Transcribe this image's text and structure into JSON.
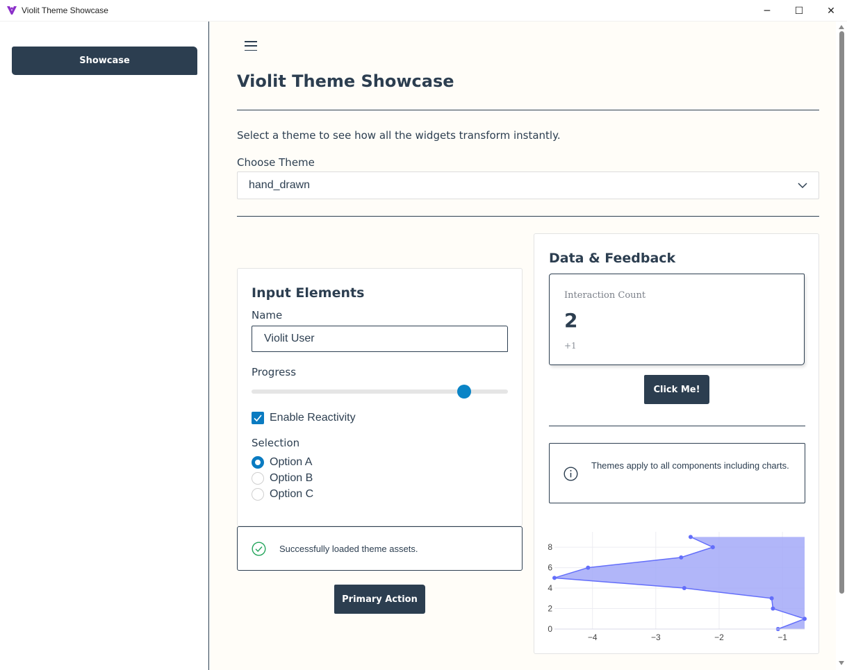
{
  "window": {
    "title": "Violit Theme Showcase",
    "minimize": "─",
    "maximize": "☐",
    "close": "✕"
  },
  "sidebar": {
    "nav_button": "Showcase"
  },
  "header": {
    "title": "Violit Theme Showcase",
    "subtitle": "Select a theme to see how all the widgets transform instantly."
  },
  "theme_select": {
    "label": "Choose Theme",
    "value": "hand_drawn"
  },
  "input_card": {
    "title": "Input Elements",
    "name_label": "Name",
    "name_value": "Violit User",
    "progress_label": "Progress",
    "progress_value": 0.83,
    "checkbox_label": "Enable Reactivity",
    "checkbox_checked": true,
    "selection_label": "Selection",
    "options": [
      "Option A",
      "Option B",
      "Option C"
    ],
    "selected_option": 0
  },
  "success_alert": {
    "text": "Successfully loaded theme assets."
  },
  "primary_button": "Primary Action",
  "data_card": {
    "title": "Data & Feedback",
    "metric_label": "Interaction Count",
    "metric_value": "2",
    "metric_delta": "+1",
    "click_button": "Click Me!",
    "info_text": "Themes apply to all components including charts."
  },
  "chart_data": {
    "type": "area",
    "series": [
      {
        "x": [
          -1.07,
          -0.65,
          -1.15,
          -1.17,
          -2.55,
          -4.6,
          -4.07,
          -2.6,
          -2.1,
          -2.45
        ],
        "y": [
          0,
          1,
          2,
          3,
          4,
          5,
          6,
          7,
          8,
          9
        ]
      }
    ],
    "xlim": [
      -4.6,
      -0.65
    ],
    "ylim": [
      0,
      9.5
    ],
    "x_ticks": [
      "−4",
      "−3",
      "−2",
      "−1"
    ],
    "y_ticks": [
      "0",
      "2",
      "4",
      "6",
      "8"
    ],
    "line_color": "#636efa",
    "fill_color": "#a3a9f8",
    "grid": true
  }
}
